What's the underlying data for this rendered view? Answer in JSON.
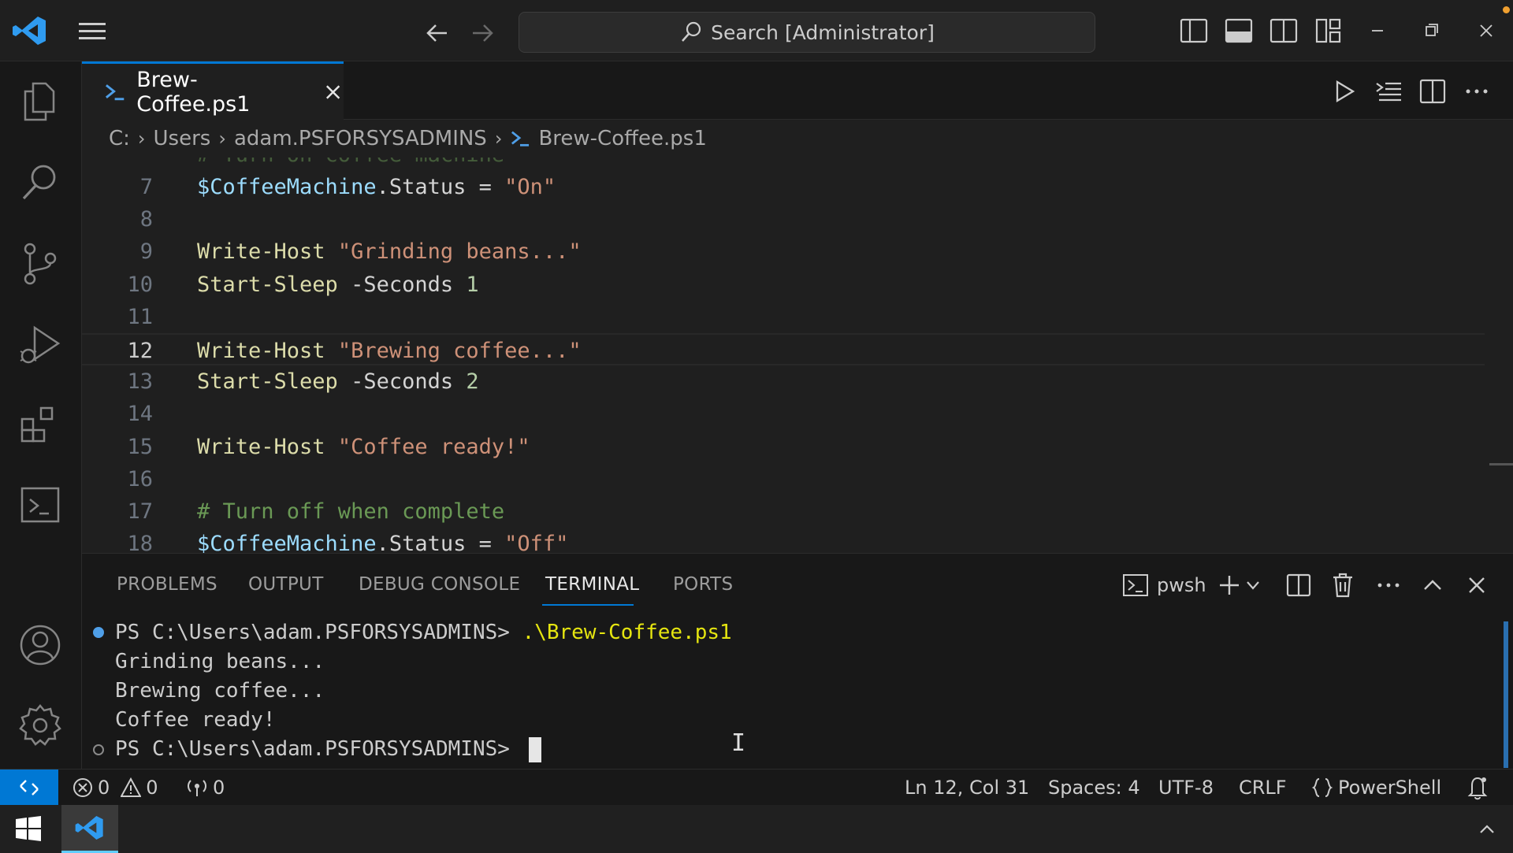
{
  "titlebar": {
    "search_label": "Search [Administrator]"
  },
  "tab": {
    "name": "Brew-Coffee.ps1"
  },
  "breadcrumb": {
    "items": [
      "C:",
      "Users",
      "adam.PSFORSYSADMINS",
      "Brew-Coffee.ps1"
    ]
  },
  "editor": {
    "partial_top_line": "# Turn on coffee machine",
    "lines": [
      {
        "n": "7",
        "tokens": [
          [
            "var",
            "$CoffeeMachine"
          ],
          [
            "plain",
            ".Status = "
          ],
          [
            "str",
            "\"On\""
          ]
        ]
      },
      {
        "n": "8",
        "tokens": []
      },
      {
        "n": "9",
        "tokens": [
          [
            "cmd",
            "Write-Host"
          ],
          [
            "plain",
            " "
          ],
          [
            "str",
            "\"Grinding beans...\""
          ]
        ]
      },
      {
        "n": "10",
        "tokens": [
          [
            "cmd",
            "Start-Sleep"
          ],
          [
            "plain",
            " -Seconds "
          ],
          [
            "num",
            "1"
          ]
        ]
      },
      {
        "n": "11",
        "tokens": []
      },
      {
        "n": "12",
        "tokens": [
          [
            "cmd",
            "Write-Host"
          ],
          [
            "plain",
            " "
          ],
          [
            "str",
            "\"Brewing coffee...\""
          ]
        ]
      },
      {
        "n": "13",
        "tokens": [
          [
            "cmd",
            "Start-Sleep"
          ],
          [
            "plain",
            " -Seconds "
          ],
          [
            "num",
            "2"
          ]
        ]
      },
      {
        "n": "14",
        "tokens": []
      },
      {
        "n": "15",
        "tokens": [
          [
            "cmd",
            "Write-Host"
          ],
          [
            "plain",
            " "
          ],
          [
            "str",
            "\"Coffee ready!\""
          ]
        ]
      },
      {
        "n": "16",
        "tokens": []
      },
      {
        "n": "17",
        "tokens": [
          [
            "cmt",
            "# Turn off when complete"
          ]
        ]
      },
      {
        "n": "18",
        "tokens": [
          [
            "var",
            "$CoffeeMachine"
          ],
          [
            "plain",
            ".Status = "
          ],
          [
            "str",
            "\"Off\""
          ]
        ]
      }
    ],
    "current_line": "12"
  },
  "panel": {
    "tabs": [
      "PROBLEMS",
      "OUTPUT",
      "DEBUG CONSOLE",
      "TERMINAL",
      "PORTS"
    ],
    "active_tab": "TERMINAL",
    "shell_name": "pwsh"
  },
  "terminal": {
    "prompt": "PS C:\\Users\\adam.PSFORSYSADMINS> ",
    "command": ".\\Brew-Coffee.ps1",
    "output": [
      "Grinding beans...",
      "Brewing coffee...",
      "Coffee ready!"
    ]
  },
  "statusbar": {
    "errors": "0",
    "warnings": "0",
    "ports": "0",
    "position": "Ln 12, Col 31",
    "spaces": "Spaces: 4",
    "encoding": "UTF-8",
    "eol": "CRLF",
    "language": "PowerShell"
  },
  "colors": {
    "accent": "#0078d4",
    "variable": "#9cdcfe",
    "command": "#dcdcaa",
    "string": "#ce9178",
    "number": "#b5cea8",
    "comment": "#6a9955"
  }
}
